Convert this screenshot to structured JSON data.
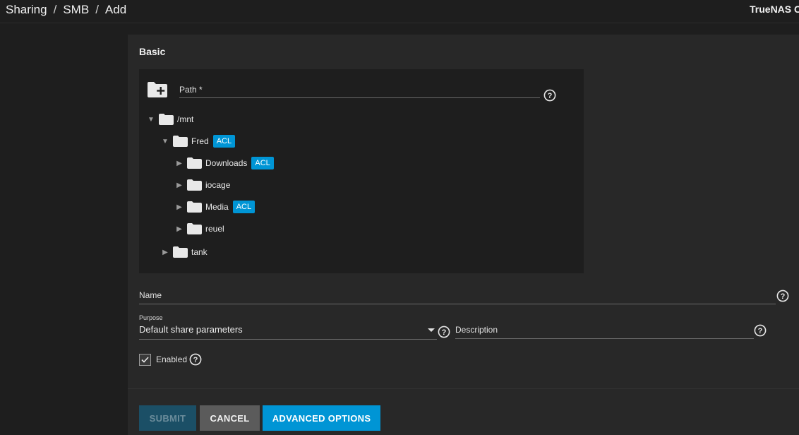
{
  "breadcrumb": {
    "items": [
      "Sharing",
      "SMB",
      "Add"
    ],
    "separator": "/"
  },
  "brand": "TrueNAS CORE",
  "form": {
    "section_title": "Basic",
    "path": {
      "label": "Path *",
      "tree": {
        "root": "/mnt",
        "fred": {
          "label": "Fred",
          "badge": "ACL"
        },
        "downloads": {
          "label": "Downloads",
          "badge": "ACL"
        },
        "iocage": {
          "label": "iocage"
        },
        "media": {
          "label": "Media",
          "badge": "ACL"
        },
        "reuel": {
          "label": "reuel"
        },
        "tank": {
          "label": "tank"
        }
      }
    },
    "name": {
      "label": "Name"
    },
    "purpose": {
      "label": "Purpose",
      "value": "Default share parameters"
    },
    "description": {
      "label": "Description"
    },
    "enabled": {
      "label": "Enabled",
      "checked": true
    }
  },
  "buttons": {
    "submit": "SUBMIT",
    "cancel": "CANCEL",
    "advanced": "ADVANCED OPTIONS"
  },
  "icons": {
    "help": "help-circle-icon",
    "folder": "folder-icon",
    "add_folder": "folder-plus-icon"
  },
  "colors": {
    "accent": "#0095d5",
    "background": "#1e1e1e",
    "card": "#282828"
  }
}
